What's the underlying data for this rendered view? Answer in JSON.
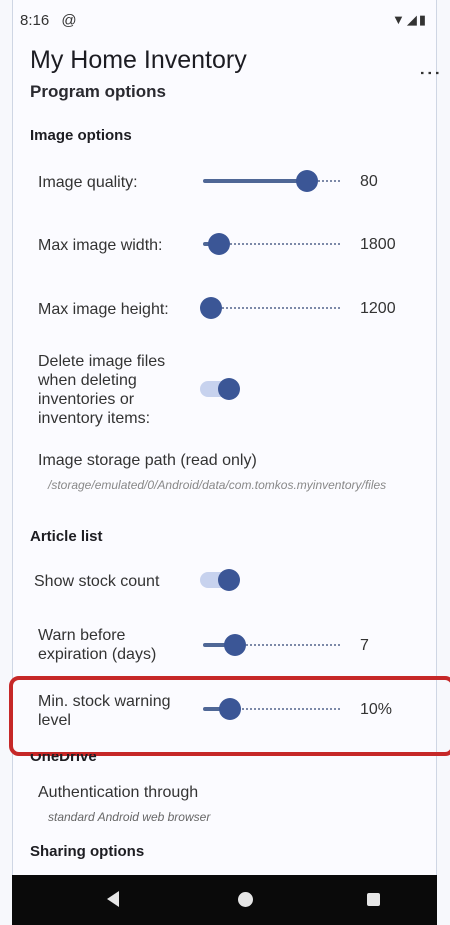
{
  "status_bar": {
    "time": "8:16",
    "app_icon": "@",
    "icons": "▼◢▮"
  },
  "header": {
    "title": "My Home Inventory",
    "subtitle": "Program options",
    "menu_icon": "more-vert-icon",
    "menu_glyph": "⋮"
  },
  "sections": {
    "image_options": "Image options",
    "article_list": "Article list",
    "onedrive": "OneDrive",
    "sharing": "Sharing options"
  },
  "image_quality": {
    "label": "Image quality:",
    "value": "80",
    "fraction": 0.76
  },
  "max_width": {
    "label": "Max image width:",
    "value": "1800",
    "fraction": 0.12
  },
  "max_height": {
    "label": "Max image height:",
    "value": "1200",
    "fraction": 0.06
  },
  "delete_images": {
    "label": "Delete image files when deleting inventories or inventory items:",
    "on": true
  },
  "storage_path": {
    "label": "Image storage path (read only)",
    "value": "/storage/emulated/0/Android/data/com.tomkos.myinventory/files"
  },
  "show_stock": {
    "label": "Show stock count",
    "on": true
  },
  "warn_expiration": {
    "label": "Warn before expiration (days)",
    "value": "7",
    "fraction": 0.23
  },
  "min_stock": {
    "label": "Min. stock warning level",
    "value": "10%",
    "fraction": 0.2
  },
  "authentication": {
    "label": "Authentication through",
    "value": "standard Android web browser"
  },
  "colors": {
    "accent": "#3b5696",
    "highlight": "#c62828"
  }
}
